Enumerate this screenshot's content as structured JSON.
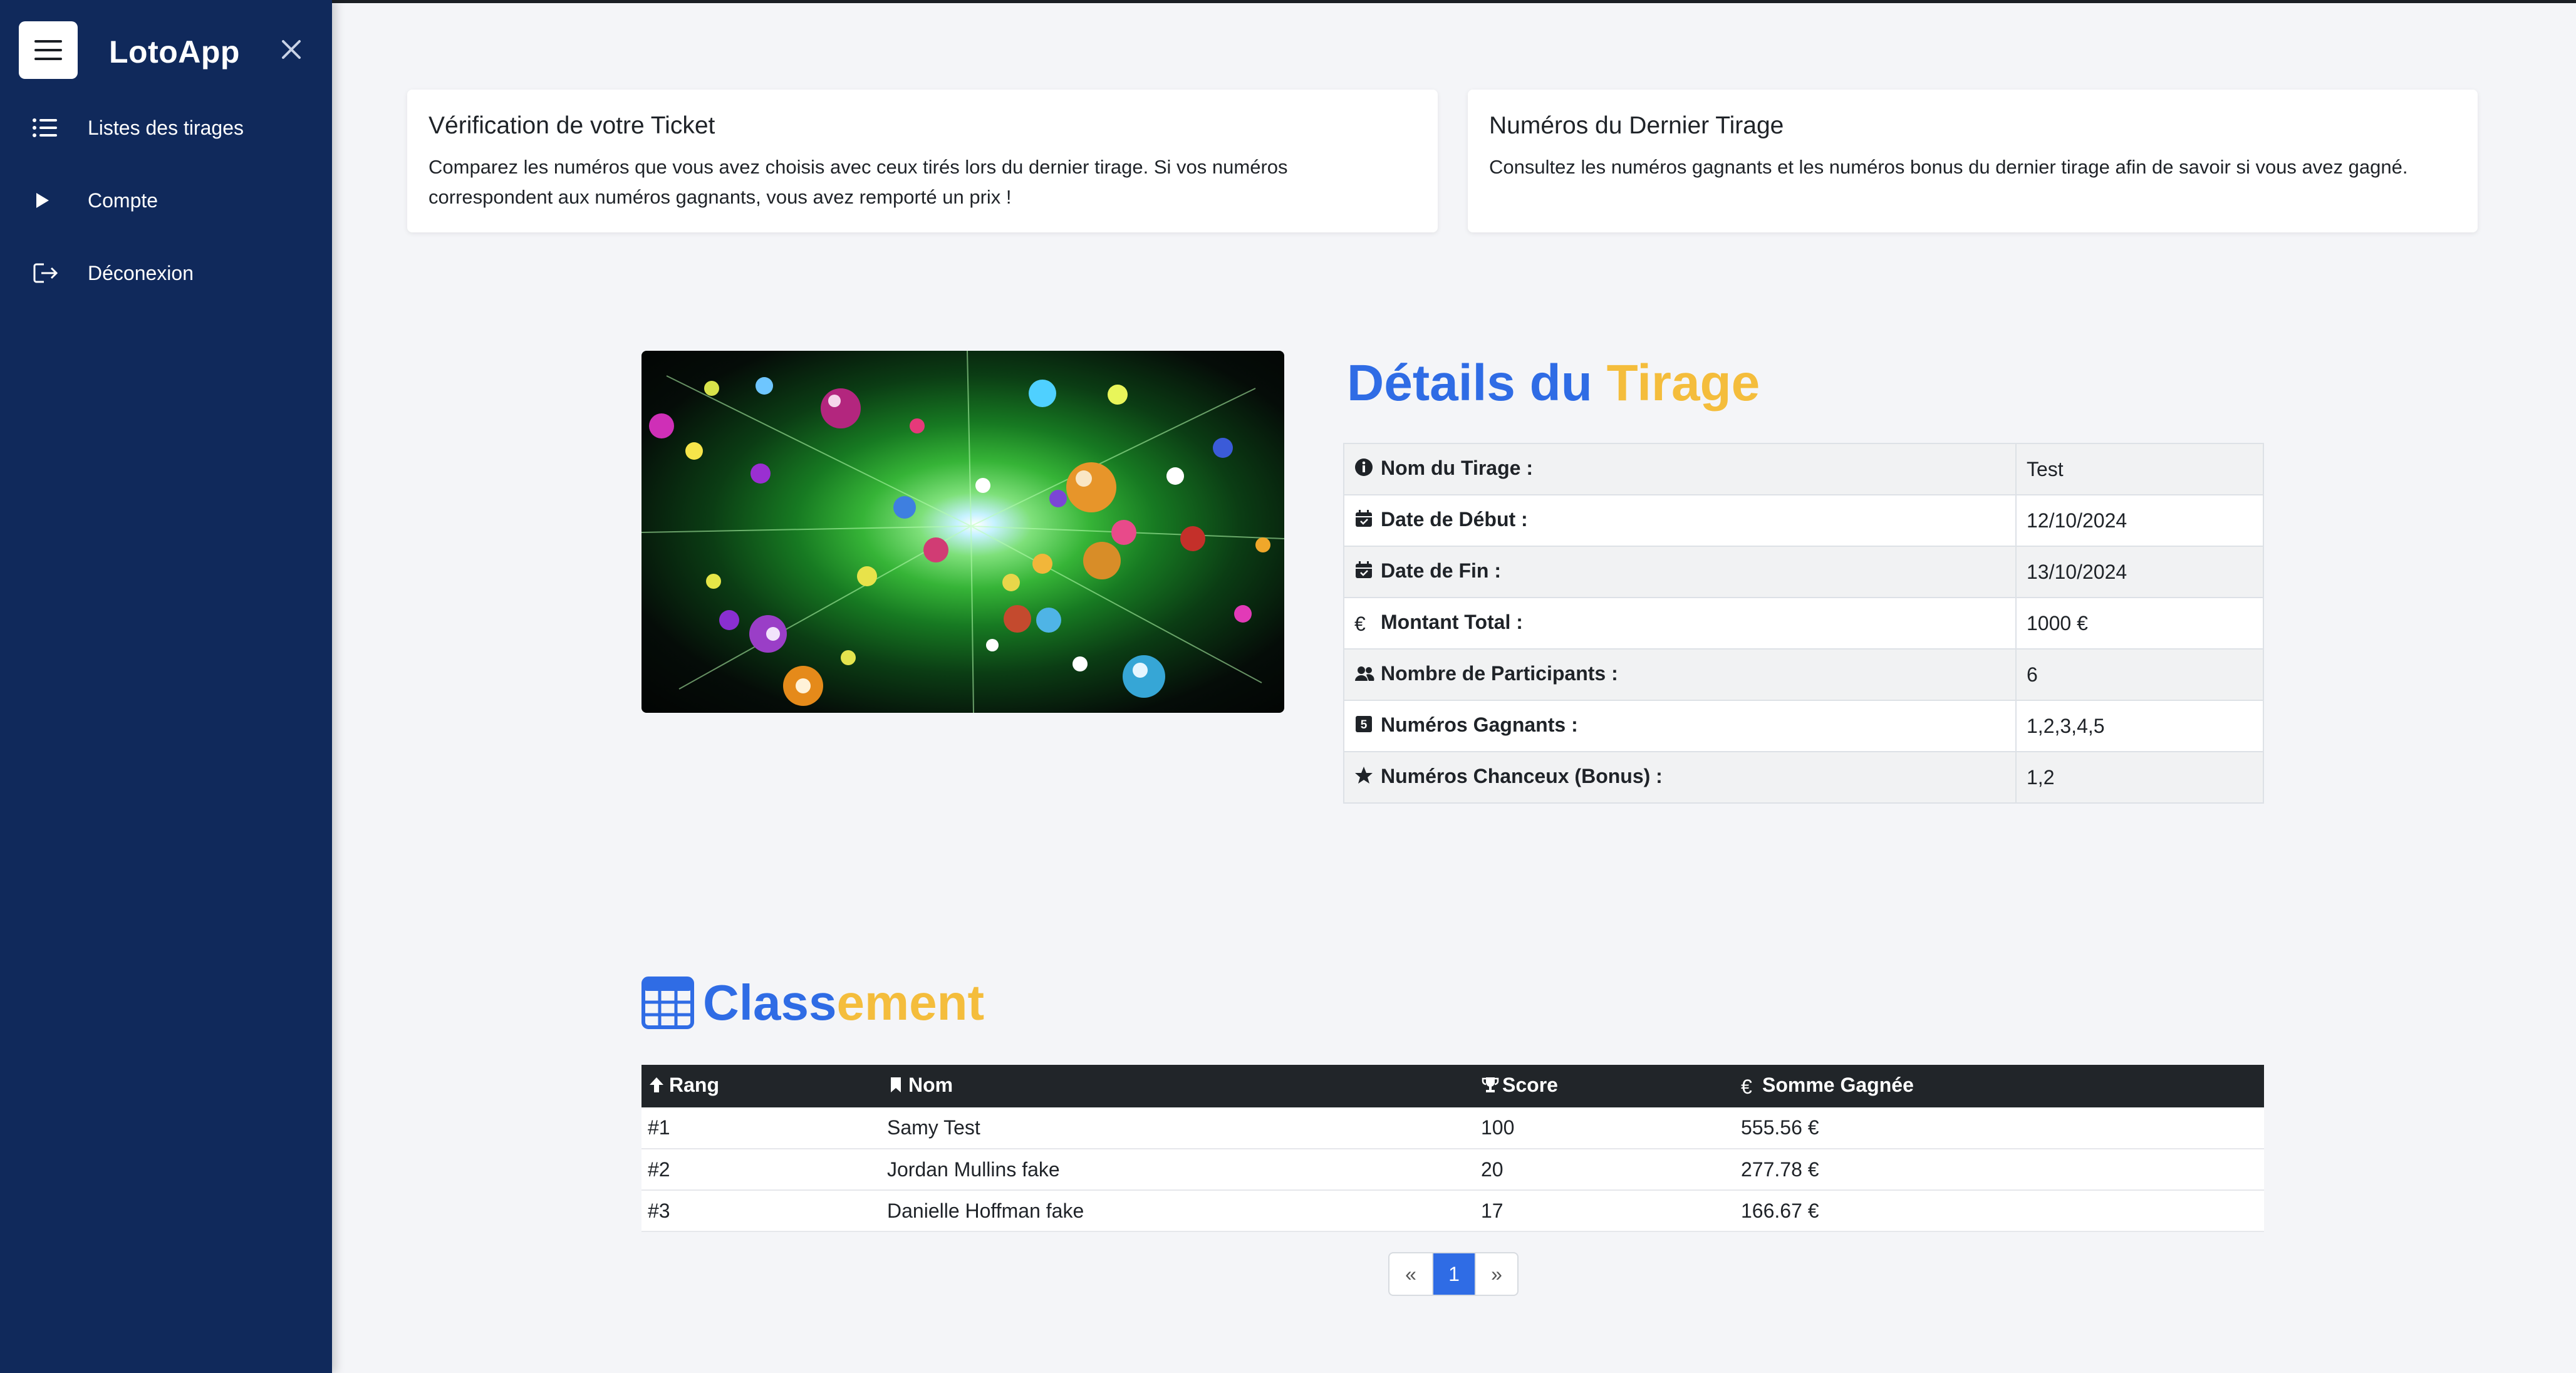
{
  "sidebar": {
    "app_title": "LotoApp",
    "items": [
      {
        "label": "Listes des tirages",
        "icon": "list-icon"
      },
      {
        "label": "Compte",
        "icon": "play-icon"
      },
      {
        "label": "Déconexion",
        "icon": "logout-icon"
      }
    ]
  },
  "cards": [
    {
      "title": "Vérification de votre Ticket",
      "text": "Comparez les numéros que vous avez choisis avec ceux tirés lors du dernier tirage. Si vos numéros correspondent aux numéros gagnants, vous avez remporté un prix !"
    },
    {
      "title": "Numéros du Dernier Tirage",
      "text": "Consultez les numéros gagnants et les numéros bonus du dernier tirage afin de savoir si vous avez gagné."
    }
  ],
  "details": {
    "title_part1": "Détails du ",
    "title_part2": "Tirage",
    "rows": [
      {
        "icon": "info-icon",
        "label": "Nom du Tirage :",
        "value": "Test"
      },
      {
        "icon": "calendar-icon",
        "label": "Date de Début :",
        "value": "12/10/2024"
      },
      {
        "icon": "calendar-icon",
        "label": "Date de Fin :",
        "value": "13/10/2024"
      },
      {
        "icon": "euro-icon",
        "label": "Montant Total :",
        "value": "1000 €"
      },
      {
        "icon": "users-icon",
        "label": "Nombre de Participants :",
        "value": "6"
      },
      {
        "icon": "number-5-icon",
        "label": "Numéros Gagnants :",
        "value": "1,2,3,4,5"
      },
      {
        "icon": "star-icon",
        "label": "Numéros Chanceux (Bonus) :",
        "value": "1,2"
      }
    ]
  },
  "classement": {
    "title_part1": "Class",
    "title_part2": "ement",
    "headers": [
      "Rang",
      "Nom",
      "Score",
      "Somme Gagnée"
    ],
    "rows": [
      {
        "rank": "#1",
        "name": "Samy Test",
        "score": "100",
        "amount": "555.56 €"
      },
      {
        "rank": "#2",
        "name": "Jordan Mullins fake",
        "score": "20",
        "amount": "277.78 €"
      },
      {
        "rank": "#3",
        "name": "Danielle Hoffman fake",
        "score": "17",
        "amount": "166.67 €"
      }
    ]
  },
  "pagination": {
    "prev": "«",
    "current": "1",
    "next": "»"
  },
  "colors": {
    "sidebar": "#10295b",
    "accent_blue": "#2f6ce5",
    "accent_yellow": "#f4bd3c"
  }
}
